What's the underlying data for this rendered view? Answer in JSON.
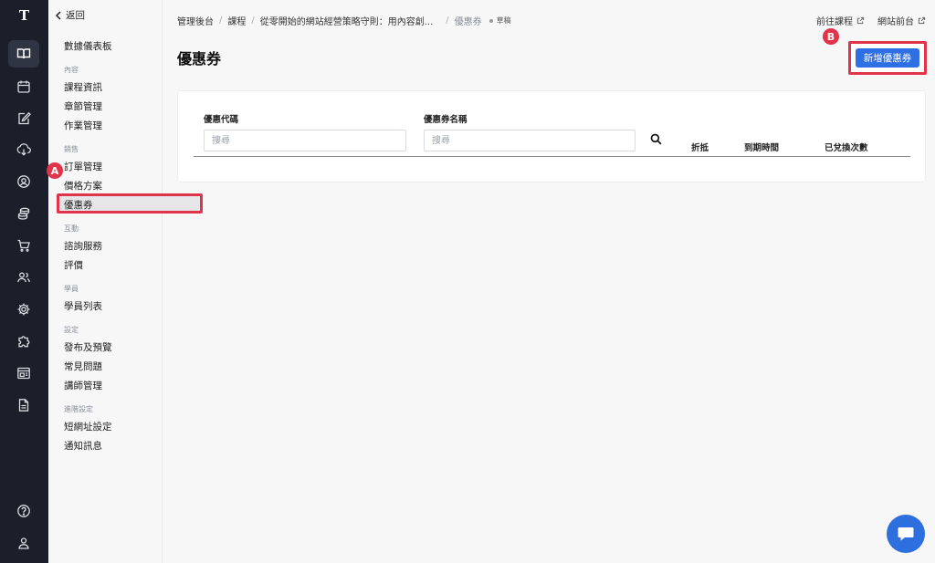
{
  "rail": {
    "logo": "T",
    "icons": [
      "book-icon",
      "calendar-icon",
      "edit-icon",
      "download-icon",
      "user-circle-icon",
      "coins-icon",
      "cart-icon",
      "users-icon",
      "gear-icon",
      "puzzle-icon",
      "layout-icon",
      "document-icon",
      "help-icon",
      "account-icon"
    ]
  },
  "sidebar": {
    "back_label": "返回",
    "dashboard": "數據儀表板",
    "groups": [
      {
        "title": "內容",
        "items": [
          "課程資訊",
          "章節管理",
          "作業管理"
        ]
      },
      {
        "title": "銷售",
        "items": [
          "訂單管理",
          "價格方案",
          "優惠券"
        ]
      },
      {
        "title": "互動",
        "items": [
          "諮詢服務",
          "評價"
        ]
      },
      {
        "title": "學員",
        "items": [
          "學員列表"
        ]
      },
      {
        "title": "設定",
        "items": [
          "發布及預覽",
          "常見問題",
          "講師管理"
        ]
      },
      {
        "title": "進階設定",
        "items": [
          "短網址設定",
          "通知訊息"
        ]
      }
    ],
    "selected": "優惠券"
  },
  "annotations": {
    "a": "A",
    "b": "B"
  },
  "breadcrumb": {
    "items": [
      "管理後台",
      "課程",
      "從零開始的網站經營策略守則：用內容創...",
      "優惠券"
    ],
    "status": "草稿"
  },
  "toplinks": {
    "course": "前往課程",
    "site": "網站前台"
  },
  "page": {
    "title": "優惠券",
    "new_button": "新增優惠券"
  },
  "filters": {
    "code_label": "優惠代碼",
    "code_placeholder": "搜尋",
    "name_label": "優惠券名稱",
    "name_placeholder": "搜尋"
  },
  "columns": [
    "折抵",
    "到期時間",
    "已兌換次數"
  ],
  "colors": {
    "accent": "#2f6fe4",
    "highlight": "#e0344a",
    "rail": "#1b1f2a"
  }
}
